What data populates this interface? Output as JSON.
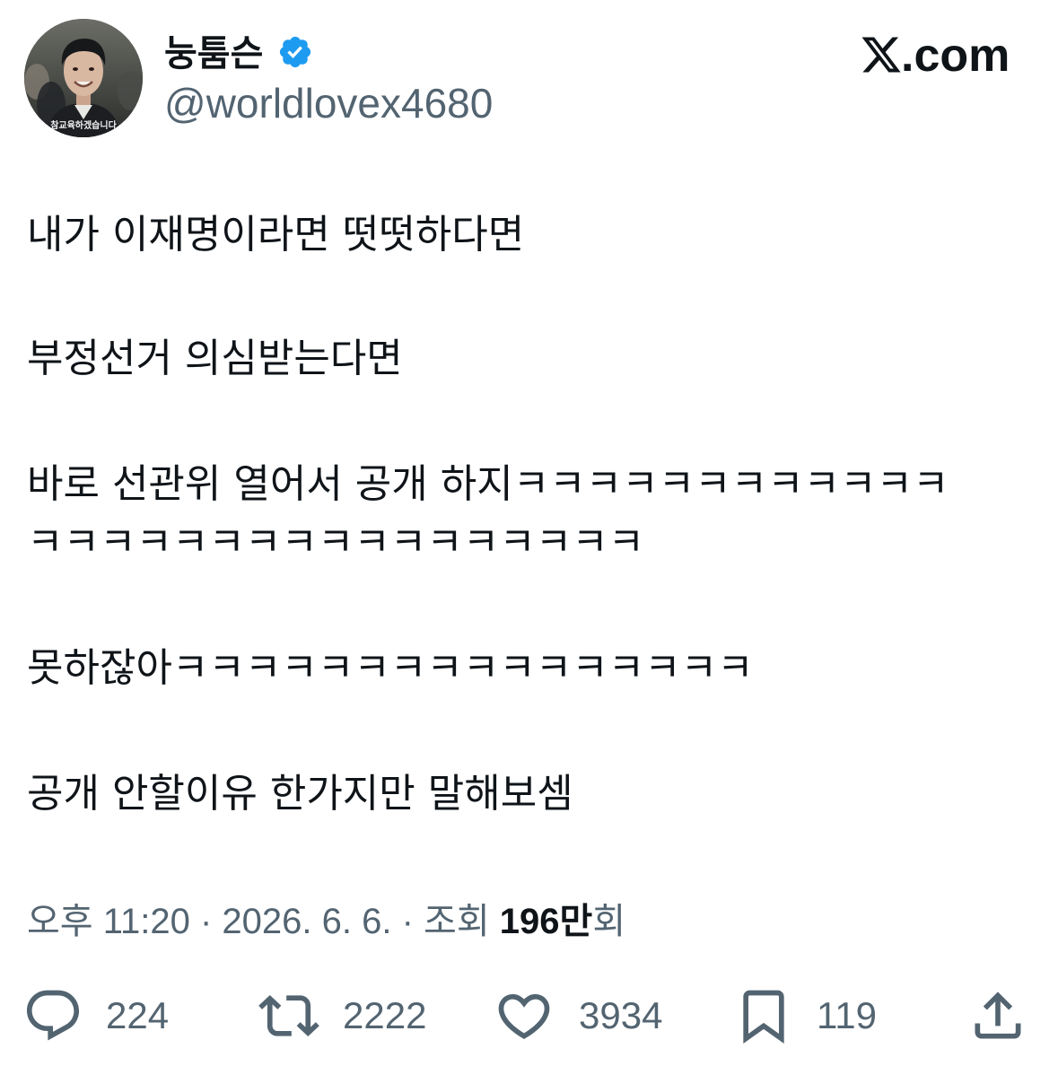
{
  "author": {
    "name": "눙툼슨",
    "handle": "@worldlovex4680",
    "verified": true,
    "avatar_caption": "참교육하겠습니다"
  },
  "brand": {
    "logo_icon": "x-logo-icon",
    "suffix": ".com"
  },
  "tweet": {
    "lines": [
      "내가 이재명이라면 떳떳하다면",
      "부정선거 의심받는다면",
      "바로 선관위 열어서 공개 하지ㅋㅋㅋㅋㅋㅋㅋㅋㅋㅋㅋㅋ",
      "ㅋㅋㅋㅋㅋㅋㅋㅋㅋㅋㅋㅋㅋㅋㅋㅋㅋ",
      "못하잖아ㅋㅋㅋㅋㅋㅋㅋㅋㅋㅋㅋㅋㅋㅋㅋㅋ",
      "공개 안할이유 한가지만 말해보셈"
    ]
  },
  "meta": {
    "time": "오후 11:20",
    "separator": "·",
    "date": "2026. 6. 6.",
    "views_label": "조회",
    "views_count": "196만",
    "views_suffix": "회"
  },
  "actions": {
    "reply_count": "224",
    "retweet_count": "2222",
    "like_count": "3934",
    "bookmark_count": "119"
  },
  "icons": {
    "verified": "verified-badge-icon",
    "reply": "reply-icon",
    "retweet": "retweet-icon",
    "like": "heart-icon",
    "bookmark": "bookmark-icon",
    "share": "share-icon"
  },
  "colors": {
    "text": "#0f1419",
    "secondary": "#536471",
    "verified": "#1d9bf0",
    "background": "#ffffff"
  }
}
